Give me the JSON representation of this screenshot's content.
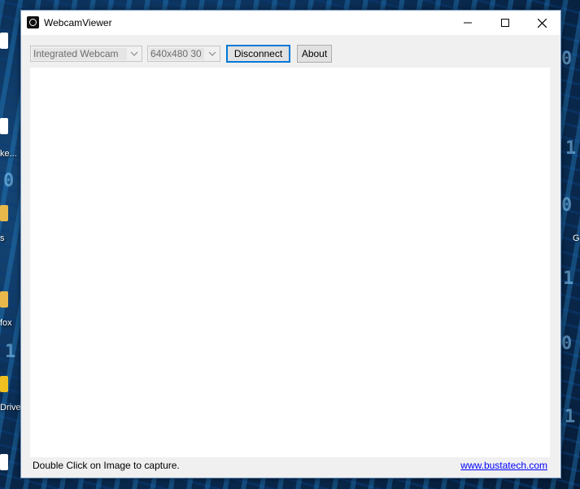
{
  "desktop": {
    "labels": [
      "ke...",
      "s",
      "fox",
      "Drive",
      "G"
    ]
  },
  "window": {
    "title": "WebcamViewer",
    "icon": "webcam-icon",
    "controls": {
      "minimize": "minimize-icon",
      "maximize": "maximize-icon",
      "close": "close-icon"
    }
  },
  "toolbar": {
    "device_select": {
      "value": "Integrated Webcam"
    },
    "resolution_select": {
      "value": "640x480 30"
    },
    "disconnect_label": "Disconnect",
    "about_label": "About"
  },
  "status": {
    "hint": "Double Click on Image to capture.",
    "link": "www.bustatech.com"
  }
}
